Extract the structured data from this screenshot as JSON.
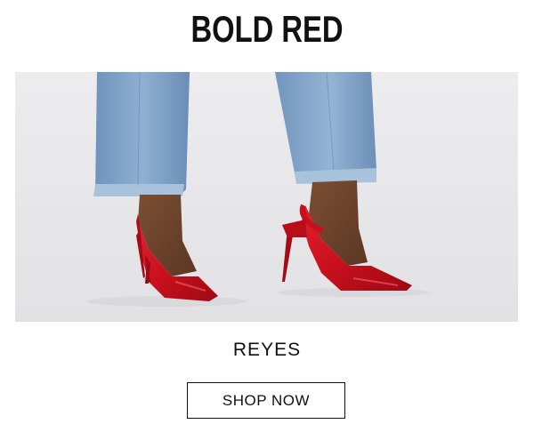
{
  "promo": {
    "headline": "BOLD RED",
    "product_name": "REYES",
    "cta_label": "SHOP NOW"
  },
  "colors": {
    "shoe_red": "#c8101c",
    "denim": "#7b9dc2",
    "backdrop": "#e8e8ea"
  }
}
